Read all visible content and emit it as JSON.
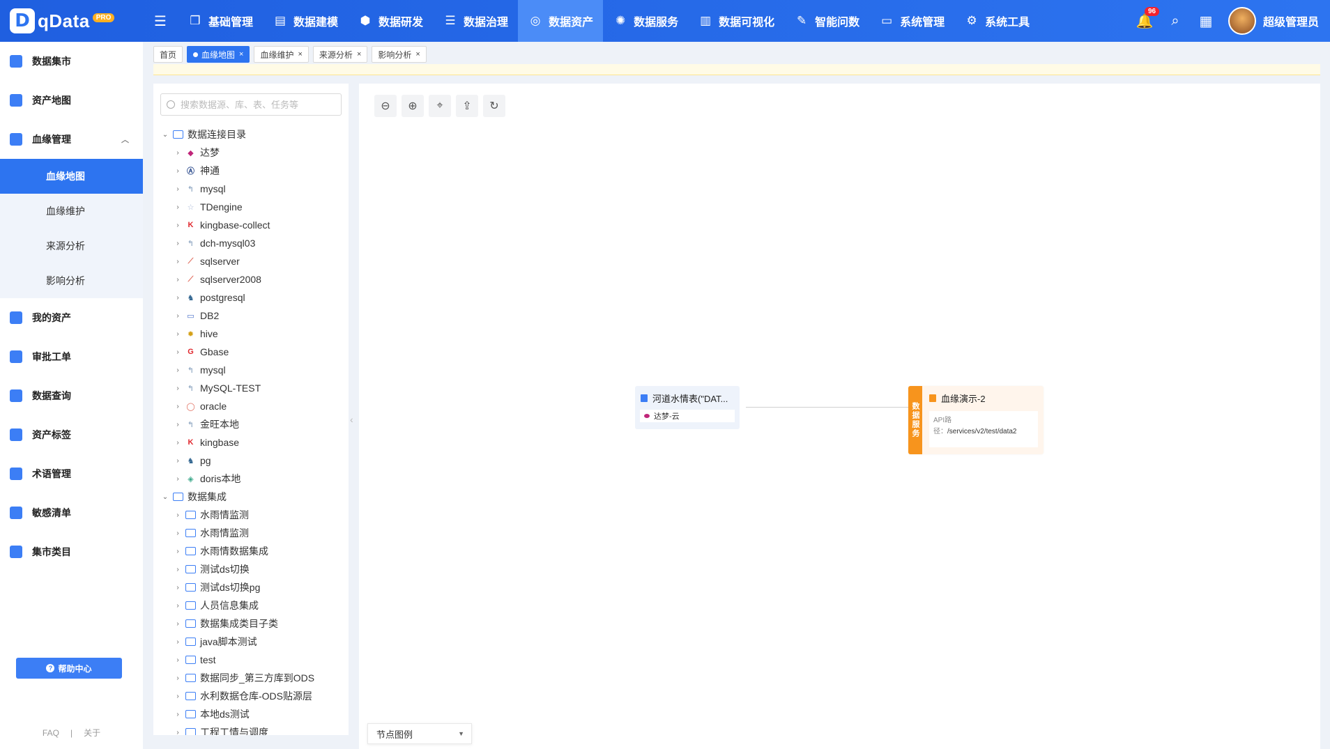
{
  "brand": {
    "logo_mark": "D",
    "name": "qData",
    "badge": "PRO"
  },
  "nav": {
    "toggle_icon": "menu-fold-icon",
    "items": [
      {
        "label": "基础管理",
        "icon": "cube-icon"
      },
      {
        "label": "数据建模",
        "icon": "book-icon"
      },
      {
        "label": "数据研发",
        "icon": "box-icon"
      },
      {
        "label": "数据治理",
        "icon": "database-icon"
      },
      {
        "label": "数据资产",
        "icon": "target-icon"
      },
      {
        "label": "数据服务",
        "icon": "gear-eye-icon"
      },
      {
        "label": "数据可视化",
        "icon": "chart-icon"
      },
      {
        "label": "智能问数",
        "icon": "chat-icon"
      },
      {
        "label": "系统管理",
        "icon": "monitor-icon"
      },
      {
        "label": "系统工具",
        "icon": "cog-icon"
      }
    ],
    "active": "数据资产"
  },
  "topright": {
    "notif_count": "96",
    "username": "超级管理员"
  },
  "sidebar": {
    "items": [
      {
        "label": "数据集市"
      },
      {
        "label": "资产地图"
      },
      {
        "label": "血缘管理"
      }
    ],
    "submenu": [
      {
        "label": "血缘地图"
      },
      {
        "label": "血缘维护"
      },
      {
        "label": "来源分析"
      },
      {
        "label": "影响分析"
      }
    ],
    "items_after": [
      {
        "label": "我的资产"
      },
      {
        "label": "审批工单"
      },
      {
        "label": "数据查询"
      },
      {
        "label": "资产标签"
      },
      {
        "label": "术语管理"
      },
      {
        "label": "敏感清单"
      },
      {
        "label": "集市类目"
      }
    ],
    "help": "帮助中心",
    "footer": {
      "faq": "FAQ",
      "sep": "|",
      "about": "关于"
    }
  },
  "tabs": [
    {
      "label": "首页"
    },
    {
      "label": "血缘地图"
    },
    {
      "label": "血缘维护"
    },
    {
      "label": "来源分析"
    },
    {
      "label": "影响分析"
    }
  ],
  "search": {
    "placeholder": "搜索数据源、库、表、任务等"
  },
  "tree": {
    "group1": {
      "label": "数据连接目录"
    },
    "connections": [
      {
        "label": "达梦",
        "icon": "dameng-icon",
        "color": "#c0267a"
      },
      {
        "label": "神通",
        "icon": "shentong-icon",
        "color": "#2b4a8c"
      },
      {
        "label": "mysql",
        "icon": "mysql-icon",
        "color": "#9bb0c8"
      },
      {
        "label": "TDengine",
        "icon": "tdengine-icon",
        "color": "#a8b8d8"
      },
      {
        "label": "kingbase-collect",
        "icon": "kingbase-icon",
        "color": "#e0282e"
      },
      {
        "label": "dch-mysql03",
        "icon": "mysql-icon",
        "color": "#9bb0c8"
      },
      {
        "label": "sqlserver",
        "icon": "sqlserver-icon",
        "color": "#e06a5a"
      },
      {
        "label": "sqlserver2008",
        "icon": "sqlserver-icon",
        "color": "#e06a5a"
      },
      {
        "label": "postgresql",
        "icon": "postgresql-icon",
        "color": "#336791"
      },
      {
        "label": "DB2",
        "icon": "db2-icon",
        "color": "#4a6fc8"
      },
      {
        "label": "hive",
        "icon": "hive-icon",
        "color": "#d4a017"
      },
      {
        "label": "Gbase",
        "icon": "gbase-icon",
        "color": "#e0282e"
      },
      {
        "label": "mysql",
        "icon": "mysql-icon",
        "color": "#9bb0c8"
      },
      {
        "label": "MySQL-TEST",
        "icon": "mysql-icon",
        "color": "#9bb0c8"
      },
      {
        "label": "oracle",
        "icon": "oracle-icon",
        "color": "#e06a5a"
      },
      {
        "label": "金旺本地",
        "icon": "mysql-icon",
        "color": "#9bb0c8"
      },
      {
        "label": "kingbase",
        "icon": "kingbase-icon",
        "color": "#e0282e"
      },
      {
        "label": "pg",
        "icon": "postgresql-icon",
        "color": "#336791"
      },
      {
        "label": "doris本地",
        "icon": "doris-icon",
        "color": "#3aa88a"
      }
    ],
    "group2": {
      "label": "数据集成"
    },
    "integrations": [
      {
        "label": "水雨情监测"
      },
      {
        "label": "水雨情监测"
      },
      {
        "label": "水雨情数据集成"
      },
      {
        "label": "测试ds切换"
      },
      {
        "label": "测试ds切换pg"
      },
      {
        "label": "人员信息集成"
      },
      {
        "label": "数据集成类目子类"
      },
      {
        "label": "java脚本测试"
      },
      {
        "label": "test"
      },
      {
        "label": "数据同步_第三方库到ODS"
      },
      {
        "label": "水利数据仓库-ODS贴源层"
      },
      {
        "label": "本地ds测试"
      },
      {
        "label": "工程工情与调度"
      }
    ]
  },
  "toolbar": [
    {
      "icon": "zoom-out-icon",
      "glyph": "⊖"
    },
    {
      "icon": "zoom-in-icon",
      "glyph": "⊕"
    },
    {
      "icon": "locate-icon",
      "glyph": "⌖"
    },
    {
      "icon": "export-icon",
      "glyph": "⇪"
    },
    {
      "icon": "refresh-icon",
      "glyph": "↻"
    }
  ],
  "graph": {
    "source_node": {
      "title": "河道水情表(\"DAT...",
      "sub": "达梦-云"
    },
    "target_node": {
      "side_label": "数据服务",
      "title": "血缘演示-2",
      "api_label": "API路径：",
      "api_path": "/services/v2/test/data2"
    }
  },
  "legend": {
    "label": "节点图例"
  },
  "colors": {
    "primary": "#2d74f0",
    "accent_orange": "#f7941d"
  }
}
